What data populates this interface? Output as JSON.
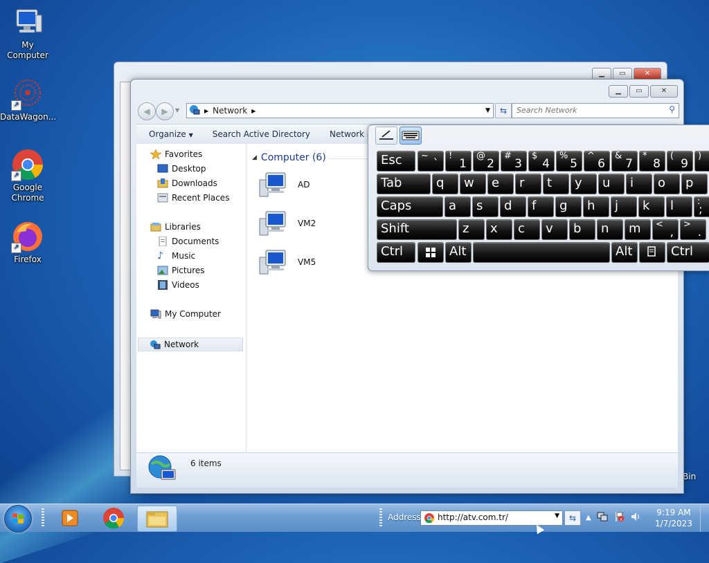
{
  "desktop": {
    "icons": [
      {
        "label": "My Computer"
      },
      {
        "label": "DataWagon..."
      },
      {
        "label": "Google Chrome"
      },
      {
        "label": "Firefox"
      }
    ],
    "recycle_label": "Bin"
  },
  "explorer": {
    "address": {
      "crumb": "Network"
    },
    "search": {
      "placeholder": "Search Network"
    },
    "toolbar": {
      "organize": "Organize",
      "search_ad": "Search Active Directory",
      "network_and_sharing": "Network and S"
    },
    "nav": {
      "favorites": "Favorites",
      "desktop": "Desktop",
      "downloads": "Downloads",
      "recent_places": "Recent Places",
      "libraries": "Libraries",
      "documents": "Documents",
      "music": "Music",
      "pictures": "Pictures",
      "videos": "Videos",
      "my_computer": "My Computer",
      "network": "Network"
    },
    "group_header": "Computer (6)",
    "computers": [
      "AD",
      "VM2",
      "VM5"
    ],
    "details": {
      "count": "6 items"
    }
  },
  "keyboard": {
    "rows": {
      "r1": {
        "esc": "Esc",
        "tilde_top": "~",
        "tilde_bot": "`",
        "k1_top": "!",
        "k1_bot": "1",
        "k2_top": "@",
        "k2_bot": "2",
        "k3_top": "#",
        "k3_bot": "3",
        "k4_top": "$",
        "k4_bot": "4",
        "k5_top": "%",
        "k5_bot": "5",
        "k6_top": "^",
        "k6_bot": "6",
        "k7_top": "&",
        "k7_bot": "7",
        "k8_top": "*",
        "k8_bot": "8",
        "k9_top": "(",
        "k9_bot": "9",
        "k0_top": ")"
      },
      "r2": {
        "tab": "Tab",
        "q": "q",
        "w": "w",
        "e": "e",
        "r": "r",
        "t": "t",
        "y": "y",
        "u": "u",
        "i": "i",
        "o": "o",
        "p": "p"
      },
      "r3": {
        "caps": "Caps",
        "a": "a",
        "s": "s",
        "d": "d",
        "f": "f",
        "g": "g",
        "h": "h",
        "j": "j",
        "k": "k",
        "l": "l",
        "semi_top": ":",
        "semi_bot": ";"
      },
      "r4": {
        "shift": "Shift",
        "z": "z",
        "x": "x",
        "c": "c",
        "v": "v",
        "b": "b",
        "n": "n",
        "m": "m",
        "comma_top": "<",
        "comma_bot": ",",
        "period_top": ">",
        "period_bot": "."
      },
      "r5": {
        "ctrl": "Ctrl",
        "alt": "Alt",
        "alt_r": "Alt",
        "ctrl_r": "Ctrl"
      }
    }
  },
  "taskbar": {
    "address_label": "Address",
    "url": "http://atv.com.tr/",
    "time": "9:19 AM",
    "date": "1/7/2023"
  }
}
